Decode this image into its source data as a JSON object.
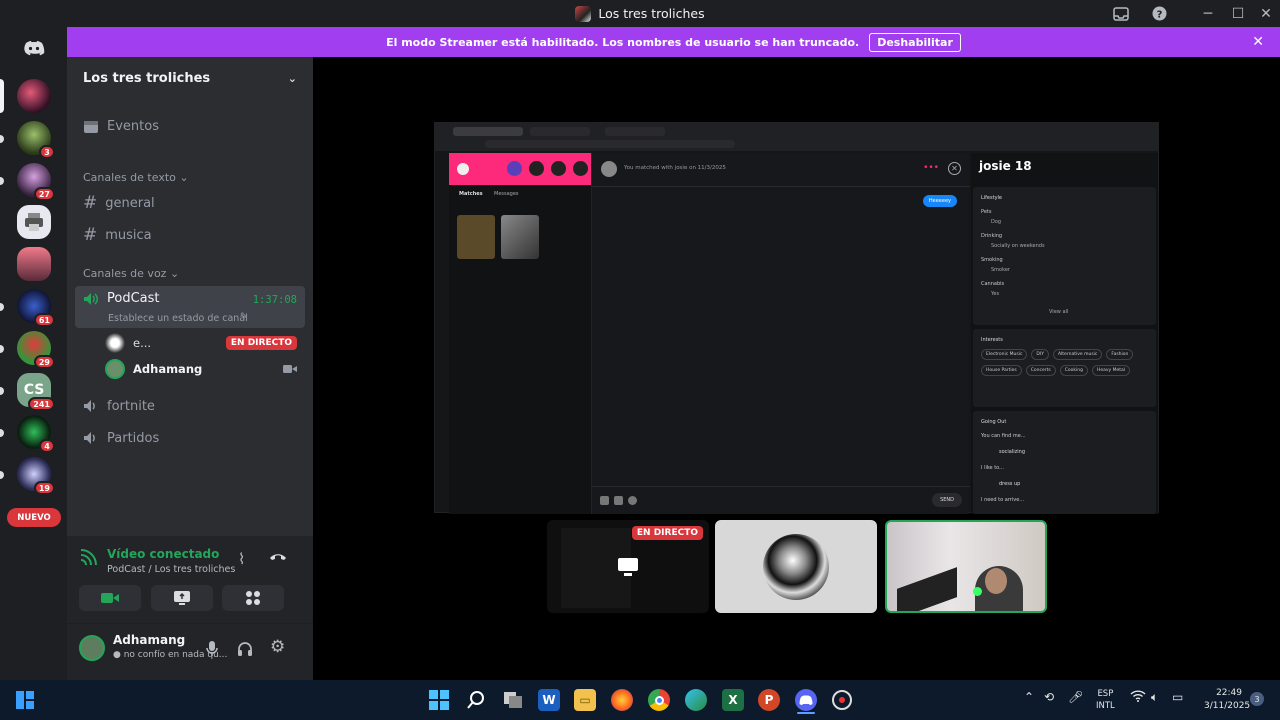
{
  "window": {
    "title": "Los tres troliches"
  },
  "banner": {
    "text": "El modo Streamer está habilitado. Los nombres de usuario se han truncado.",
    "button": "Deshabilitar"
  },
  "rail": {
    "badges": [
      "3",
      "27",
      "61",
      "29",
      "241",
      "4",
      "19"
    ],
    "nuevo": "NUEVO"
  },
  "sidebar": {
    "guild_name": "Los tres troliches",
    "events": "Eventos",
    "text_category": "Canales de texto",
    "text_channels": [
      "general",
      "musica"
    ],
    "voice_category": "Canales de voz",
    "voice_channels": {
      "podcast": {
        "name": "PodCast",
        "timer": "1:37:08",
        "status": "Establece un estado de canal"
      },
      "users": [
        {
          "name": "e...",
          "badge": "EN DIRECTO"
        },
        {
          "name": "Adhamang"
        }
      ],
      "others": [
        "fortnite",
        "Partidos"
      ]
    }
  },
  "voice_panel": {
    "status": "Vídeo conectado",
    "location": "PodCast / Los tres troliches"
  },
  "user_panel": {
    "name": "Adhamang",
    "status": "no confío en nada qu..."
  },
  "stream": {
    "profile_name": "josie 18",
    "matched_text": "You matched with josie on 11/3/2025",
    "tabs": [
      "Matches",
      "Messages"
    ],
    "message_bubble": "Heeeeey",
    "send": "SEND",
    "lifestyle": {
      "title": "Lifestyle",
      "rows": [
        {
          "label": "Pets",
          "value": "Dog"
        },
        {
          "label": "Drinking",
          "value": "Socially on weekends"
        },
        {
          "label": "Smoking",
          "value": "Smoker"
        },
        {
          "label": "Cannabis",
          "value": "Yes"
        }
      ],
      "view_all": "View all"
    },
    "interests": {
      "title": "Interests",
      "tags": [
        "Electronic Music",
        "DIY",
        "Alternative music",
        "Fashion",
        "House Parties",
        "Concerts",
        "Cooking",
        "Heavy Metal"
      ]
    },
    "going_out": {
      "title": "Going Out",
      "line1": "You can find me...",
      "item1": "socializing",
      "line2": "I like to...",
      "item2": "dress up",
      "line3": "I need to arrive..."
    }
  },
  "tiles": {
    "live_badge": "EN DIRECTO"
  },
  "taskbar": {
    "lang1": "ESP",
    "lang2": "INTL",
    "time": "22:49",
    "date": "3/11/2025",
    "notif": "3"
  },
  "colors": {
    "accent": "#a13ff0",
    "green": "#23a55a",
    "red": "#da373c"
  }
}
